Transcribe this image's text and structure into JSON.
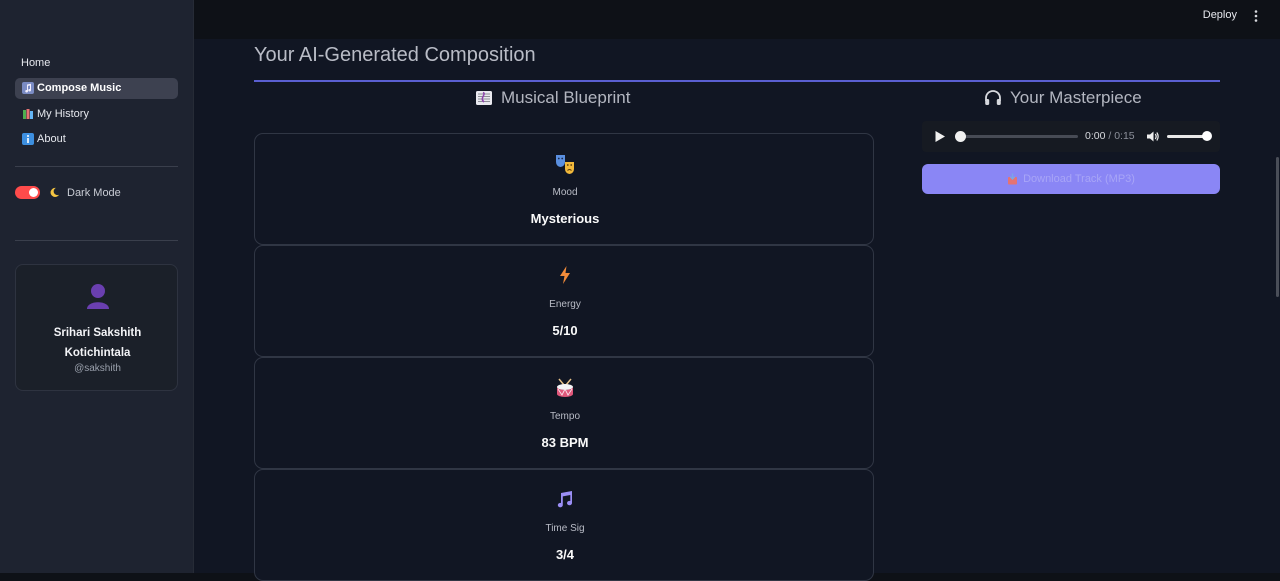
{
  "sidebar": {
    "nav": [
      {
        "label": "Home",
        "icon": ""
      },
      {
        "label": "Compose Music",
        "icon": "music-note-icon",
        "active": true
      },
      {
        "label": "My History",
        "icon": "books-icon"
      },
      {
        "label": "About",
        "icon": "info-icon"
      }
    ],
    "dark_mode": {
      "label": "Dark Mode",
      "icon": "crescent-moon-icon",
      "on": true
    },
    "profile": {
      "name_line1": "Srihari Sakshith",
      "name_line2": "Kotichintala",
      "handle": "@sakshith"
    }
  },
  "topbar": {
    "deploy_label": "Deploy"
  },
  "main": {
    "title": "Your AI-Generated Composition",
    "blueprint_heading": "Musical Blueprint",
    "masterpiece_heading": "Your Masterpiece",
    "cards": [
      {
        "label": "Mood",
        "value": "Mysterious",
        "icon": "performing-arts-icon"
      },
      {
        "label": "Energy",
        "value": "5/10",
        "icon": "lightning-icon"
      },
      {
        "label": "Tempo",
        "value": "83 BPM",
        "icon": "drum-icon"
      },
      {
        "label": "Time Sig",
        "value": "3/4",
        "icon": "music-notes-icon"
      }
    ],
    "player": {
      "current_time": "0:00",
      "separator": "/",
      "duration": "0:15",
      "progress": 0.0,
      "volume": 1.0
    },
    "download_label": "Download Track (MP3)"
  },
  "colors": {
    "accent": "#5a5fd0",
    "download_bg": "#8a86f5",
    "toggle_on": "#ff4b4b"
  }
}
